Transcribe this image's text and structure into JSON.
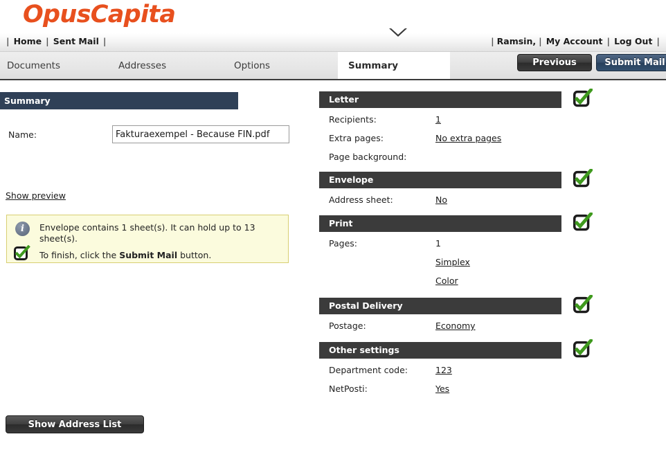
{
  "brand": {
    "logo_text": "OpusCapita",
    "logo_color": "#e8501e"
  },
  "topnav": {
    "left_items": [
      "Home",
      "Sent Mail"
    ],
    "right_items": [
      "Ramsin,",
      "My Account",
      "Log Out"
    ],
    "separator": "|"
  },
  "tabs": {
    "items": [
      {
        "label": "Documents",
        "active": false
      },
      {
        "label": "Addresses",
        "active": false
      },
      {
        "label": "Options",
        "active": false
      },
      {
        "label": "Summary",
        "active": true
      }
    ],
    "buttons": {
      "previous": "Previous",
      "submit": "Submit Mail"
    }
  },
  "left": {
    "header": "Summary",
    "name_label": "Name:",
    "name_value": "Fakturaexempel - Because FIN.pdf",
    "show_preview": "Show preview",
    "info": {
      "line1": "Envelope contains 1 sheet(s). It can hold up to 13 sheet(s).",
      "line2_prefix": "To finish, click the ",
      "line2_bold": "Submit Mail",
      "line2_suffix": " button.",
      "background_color": "#fbfbdd",
      "border_color": "#d8cf72"
    },
    "address_list_button": "Show Address List"
  },
  "sections": [
    {
      "title": "Letter",
      "status": "ok",
      "rows": [
        {
          "label": "Recipients:",
          "value": "1",
          "link": true
        },
        {
          "label": "Extra pages:",
          "value": "No extra pages",
          "link": true
        },
        {
          "label": "Page background:",
          "value": "",
          "link": false
        }
      ]
    },
    {
      "title": "Envelope",
      "status": "ok",
      "rows": [
        {
          "label": "Address sheet:",
          "value": "No",
          "link": true
        }
      ]
    },
    {
      "title": "Print",
      "status": "ok",
      "rows": [
        {
          "label": "Pages:",
          "value": "1",
          "link": false
        },
        {
          "label": "",
          "value": "Simplex",
          "link": true
        },
        {
          "label": "",
          "value": "Color",
          "link": true
        }
      ]
    },
    {
      "title": "Postal Delivery",
      "status": "ok",
      "rows": [
        {
          "label": "Postage:",
          "value": "Economy",
          "link": true
        }
      ]
    },
    {
      "title": "Other settings",
      "status": "ok",
      "rows": [
        {
          "label": "Department code:",
          "value": "123",
          "link": true
        },
        {
          "label": "NetPosti:",
          "value": "Yes",
          "link": true
        }
      ]
    }
  ],
  "colors": {
    "accent_orange": "#e8501e",
    "left_header_bg": "#2f4057",
    "section_header_bg": "#3b3b3b",
    "check_green": "#3f9a1e",
    "submit_blue": "#37506d"
  }
}
